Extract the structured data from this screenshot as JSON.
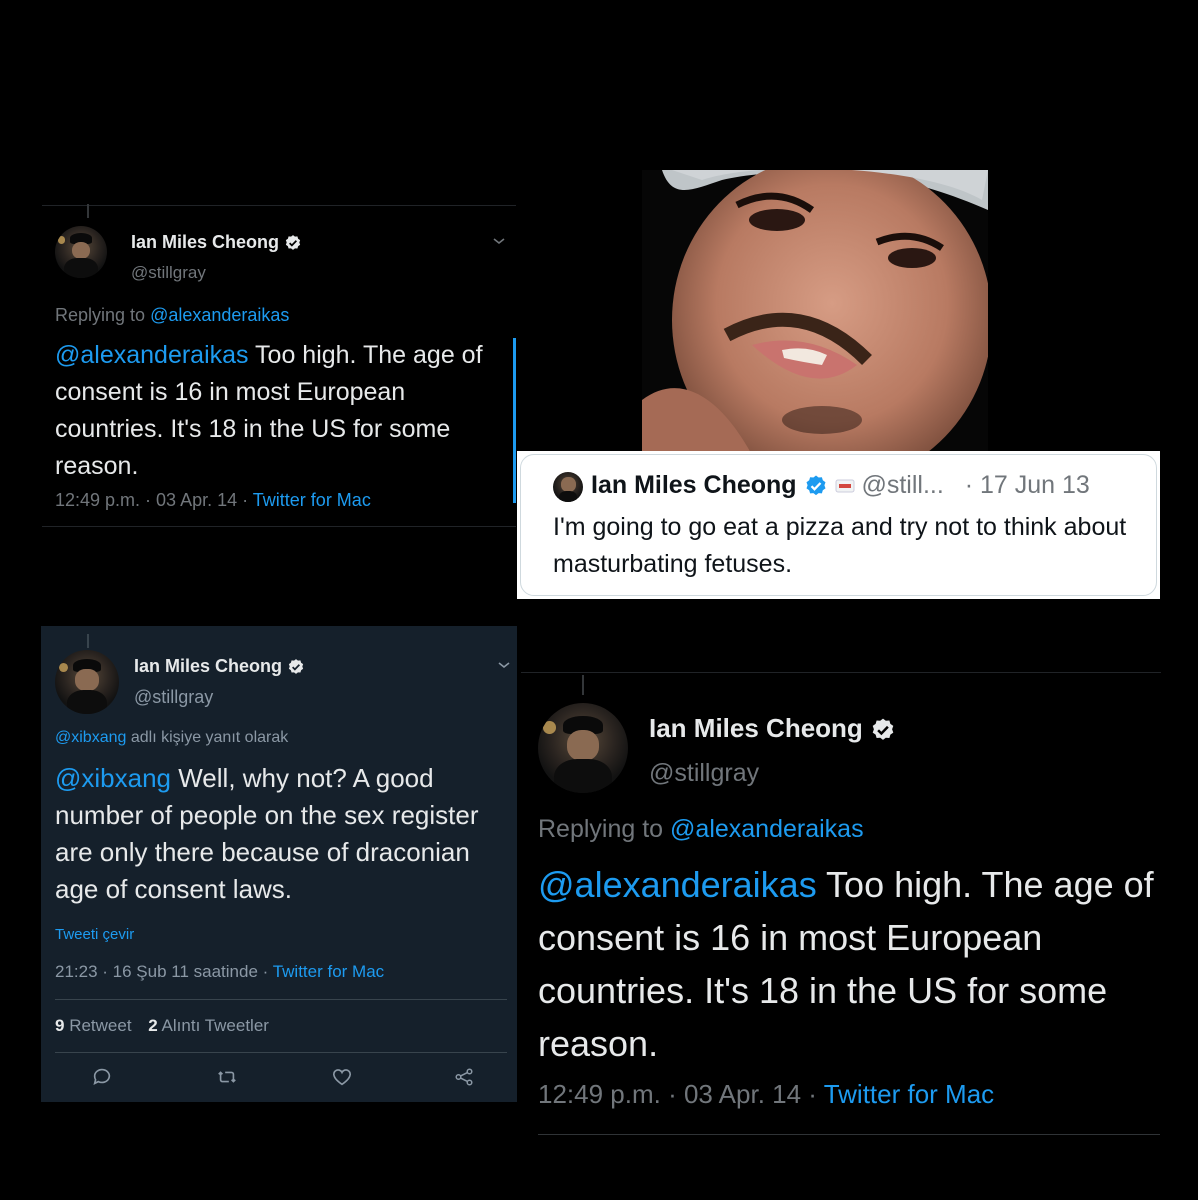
{
  "author": {
    "name": "Ian Miles Cheong",
    "handle": "@stillgray"
  },
  "tweet1": {
    "replying_prefix": "Replying to ",
    "replying_to": "@alexanderaikas",
    "mention": "@alexanderaikas",
    "text": " Too high. The age of consent is 16 in most European countries. It's 18 in the US for some reason.",
    "timestamp": "12:49 p.m. · 03 Apr. 14 · ",
    "client": "Twitter for Mac"
  },
  "quote_tweet": {
    "name": "Ian Miles Cheong",
    "handle": "@still...",
    "date": "· 17 Jun 13",
    "text": "I'm going to go eat a pizza and try not to think about masturbating fetuses."
  },
  "tweet3": {
    "replying_to": "@xibxang",
    "replying_suffix": " adlı kişiye yanıt olarak",
    "mention": "@xibxang",
    "text": " Well, why not? A good number of people on the sex register are only there because of draconian age of consent laws.",
    "translate": "Tweeti çevir",
    "timestamp": "21:23 · 16 Şub 11 saatinde · ",
    "client": "Twitter for Mac",
    "retweet_count": "9",
    "retweet_label": " Retweet",
    "quote_count": "2",
    "quote_label": " Alıntı Tweetler"
  },
  "tweet4": {
    "replying_prefix": "Replying to ",
    "replying_to": "@alexanderaikas",
    "mention": "@alexanderaikas",
    "text": " Too high. The age of consent is 16 in most European countries. It's 18 in the US for some reason.",
    "timestamp": "12:49 p.m. · 03 Apr. 14 · ",
    "client": "Twitter for Mac"
  },
  "colors": {
    "accent": "#1d9bf0",
    "dim_background": "#15202b",
    "background": "#000000"
  }
}
